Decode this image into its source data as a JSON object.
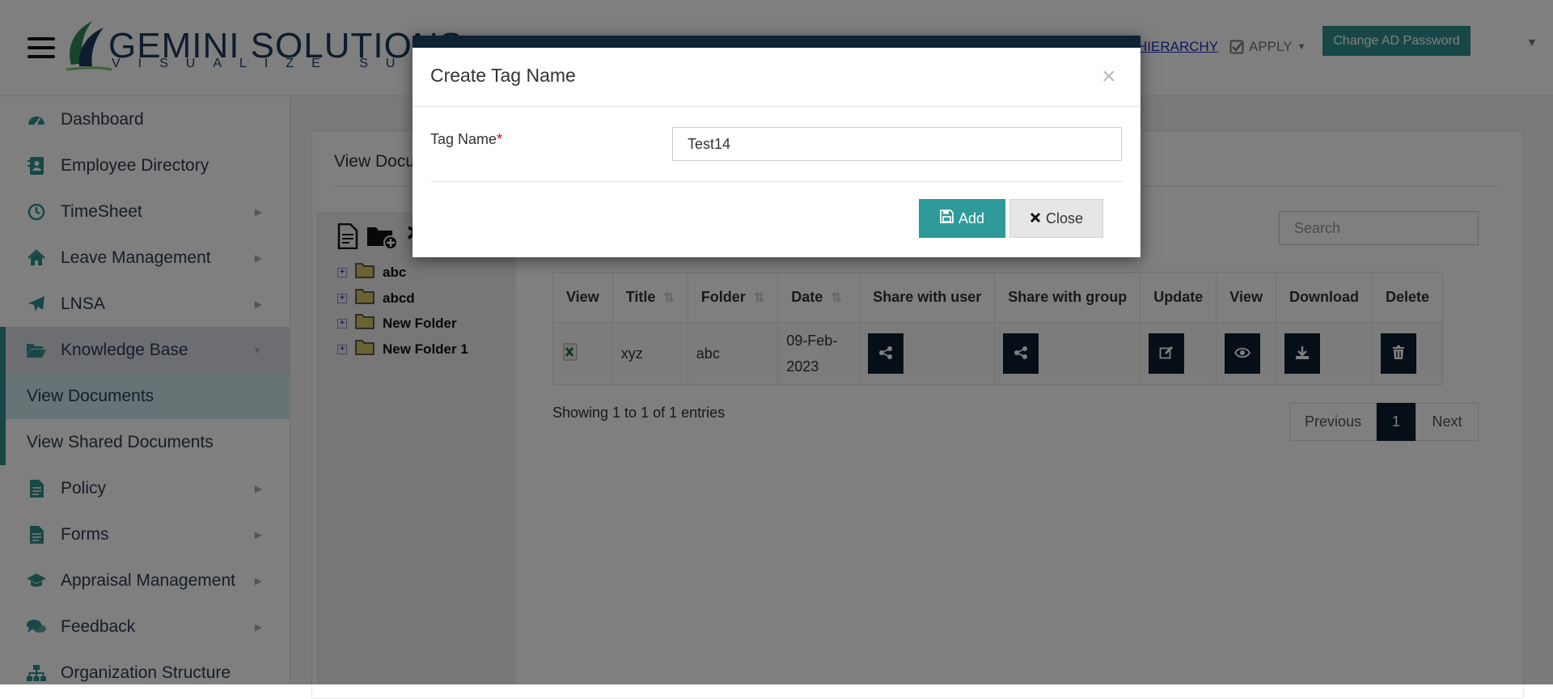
{
  "header": {
    "logo_name": "GEMINI SOLUTIONS",
    "logo_tagline": "VISUALIZE SUCCESS",
    "nav_hierarchy": "HIERARCHY",
    "nav_apply": "APPLY",
    "change_ad_password": "Change AD Password"
  },
  "sidebar": {
    "items": [
      {
        "label": "Dashboard",
        "icon": "dashboard-icon"
      },
      {
        "label": "Employee Directory",
        "icon": "address-book-icon"
      },
      {
        "label": "TimeSheet",
        "icon": "clock-icon"
      },
      {
        "label": "Leave Management",
        "icon": "home-icon"
      },
      {
        "label": "LNSA",
        "icon": "paper-plane-icon"
      },
      {
        "label": "Knowledge Base",
        "icon": "folder-open-icon"
      },
      {
        "label": "Policy",
        "icon": "file-text-icon"
      },
      {
        "label": "Forms",
        "icon": "file-text-icon"
      },
      {
        "label": "Appraisal Management",
        "icon": "graduation-cap-icon"
      },
      {
        "label": "Feedback",
        "icon": "comments-icon"
      },
      {
        "label": "Organization Structure",
        "icon": "sitemap-icon"
      }
    ],
    "sub_items": [
      "View Documents",
      "View Shared Documents"
    ]
  },
  "main": {
    "panel_title": "View Documents",
    "search_placeholder": "Search",
    "tree": [
      "abc",
      "abcd",
      "New Folder",
      "New Folder 1"
    ],
    "table": {
      "headers": [
        "View",
        "Title",
        "Folder",
        "Date",
        "Share with user",
        "Share with group",
        "Update",
        "View",
        "Download",
        "Delete"
      ],
      "rows": [
        {
          "title": "xyz",
          "folder": "abc",
          "date": "09-Feb-2023"
        }
      ]
    },
    "entries_info": "Showing 1 to 1 of 1 entries",
    "pagination": {
      "previous": "Previous",
      "page": "1",
      "next": "Next"
    }
  },
  "modal": {
    "title": "Create Tag Name",
    "close_symbol": "×",
    "field_label": "Tag Name",
    "required_mark": "*",
    "field_value": "Test14",
    "add_label": "Add",
    "close_label": "Close"
  },
  "colors": {
    "accent": "#2f8f8e",
    "dark": "#0c1f2e",
    "link": "#1e2fb5"
  }
}
